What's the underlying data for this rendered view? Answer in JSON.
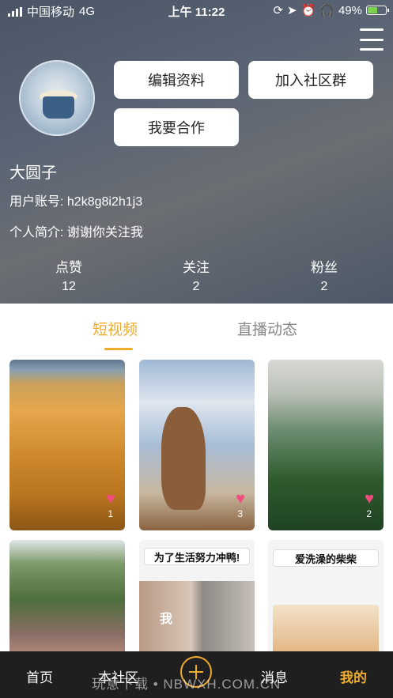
{
  "status_bar": {
    "carrier": "中国移动",
    "network": "4G",
    "time": "上午 11:22",
    "battery": "49%"
  },
  "profile": {
    "buttons": {
      "edit": "编辑资料",
      "join_group": "加入社区群",
      "cooperate": "我要合作"
    },
    "username": "大圆子",
    "account_label": "用户账号: h2k8g8i2h1j3",
    "bio_label": "个人简介: 谢谢你关注我",
    "stats": [
      {
        "label": "点赞",
        "value": "12"
      },
      {
        "label": "关注",
        "value": "2"
      },
      {
        "label": "粉丝",
        "value": "2"
      }
    ]
  },
  "tabs": [
    {
      "label": "短视频",
      "active": true
    },
    {
      "label": "直播动态",
      "active": false
    }
  ],
  "videos": [
    {
      "thumb": "wheat-field",
      "likes": "1"
    },
    {
      "thumb": "balanced-rock",
      "likes": "3"
    },
    {
      "thumb": "swans-pond",
      "likes": "2"
    },
    {
      "thumb": "koi-pond"
    },
    {
      "thumb": "cat-meme",
      "caption": "为了生活努力冲鸭!",
      "overlay": "我"
    },
    {
      "thumb": "shiba-meme",
      "caption": "爱洗澡的柴柴"
    }
  ],
  "bottom_nav": {
    "home": "首页",
    "community": "本社区",
    "messages": "消息",
    "mine": "我的"
  },
  "watermark": "玩意下载 • NBWXH.COM.CN",
  "colors": {
    "accent": "#efab2d",
    "heart": "#f24b7d",
    "nav_bg": "#1f1f1f"
  }
}
